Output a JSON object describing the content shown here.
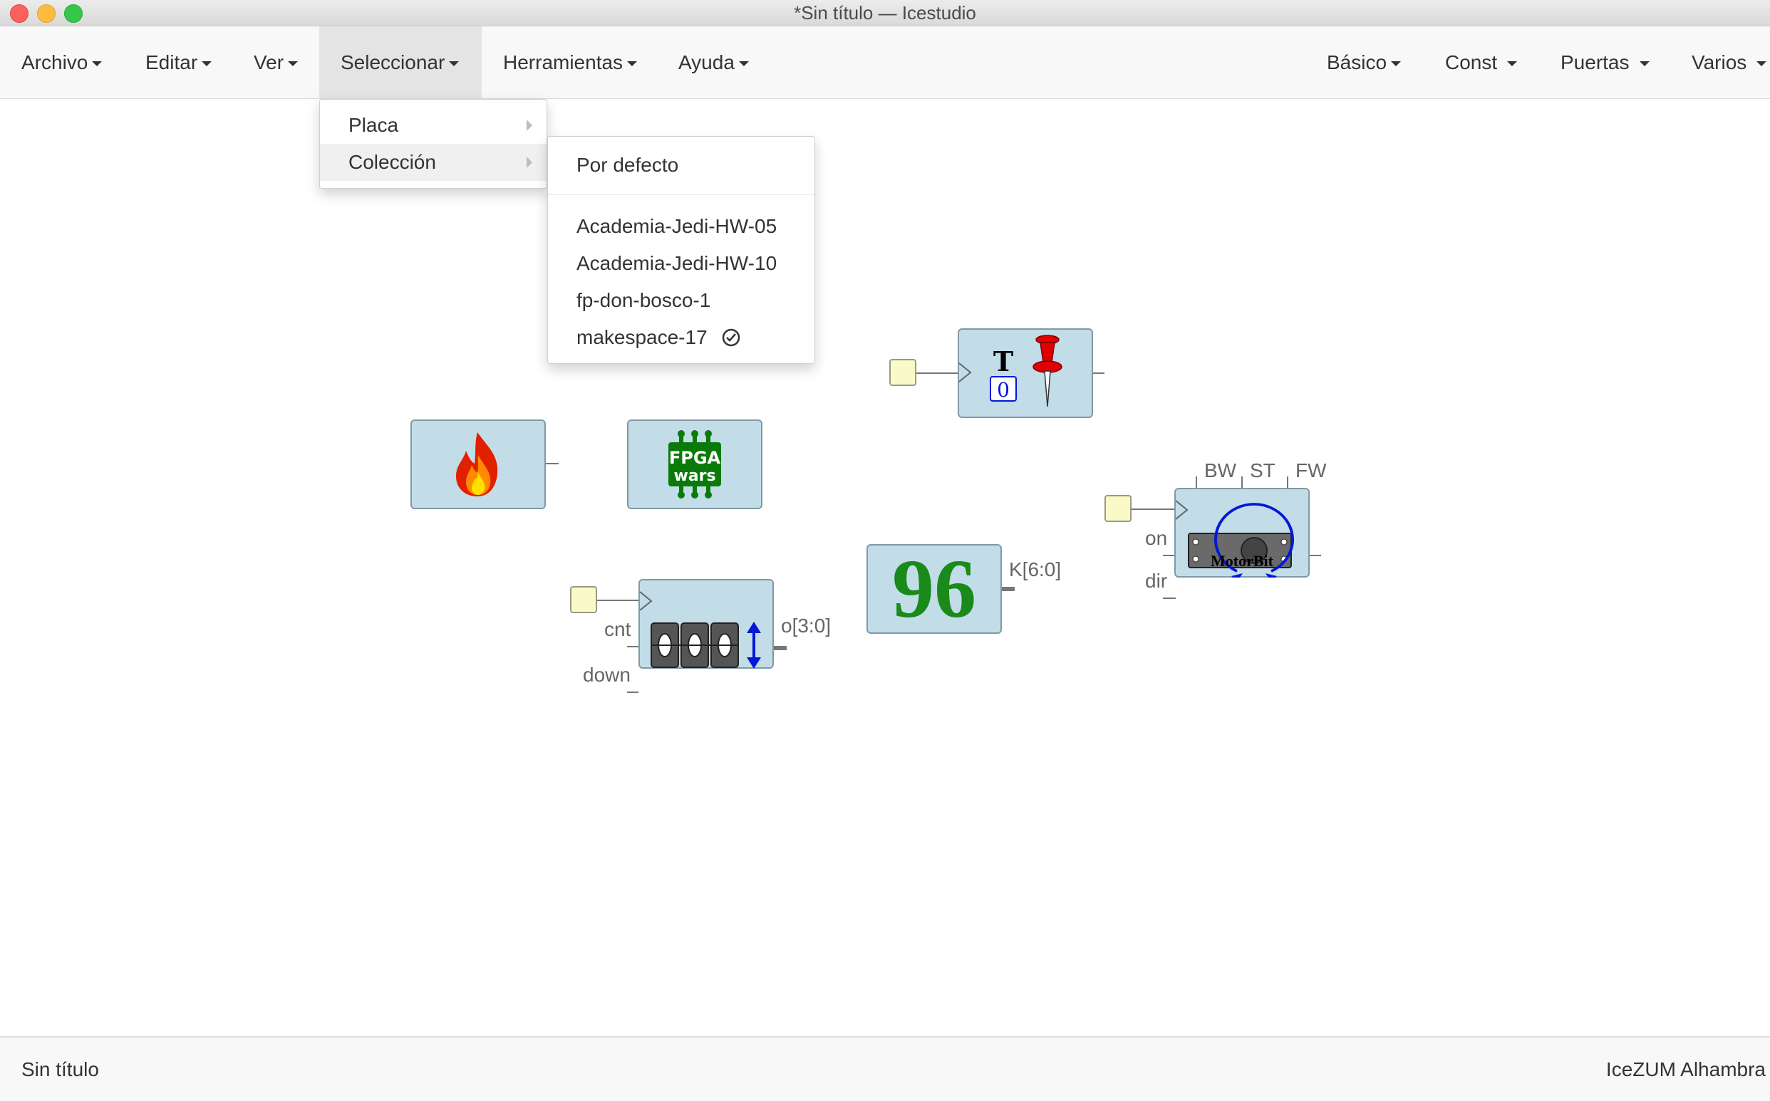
{
  "window": {
    "title": "*Sin título — Icestudio"
  },
  "menubar": {
    "left": [
      {
        "label": "Archivo"
      },
      {
        "label": "Editar"
      },
      {
        "label": "Ver"
      },
      {
        "label": "Seleccionar",
        "active": true
      },
      {
        "label": "Herramientas"
      },
      {
        "label": "Ayuda"
      }
    ],
    "right": [
      {
        "label": "Básico"
      },
      {
        "label": "Const"
      },
      {
        "label": "Puertas"
      },
      {
        "label": "Varios"
      }
    ]
  },
  "select_menu": {
    "items": [
      {
        "label": "Placa"
      },
      {
        "label": "Colección",
        "highlighted": true
      }
    ]
  },
  "collection_menu": {
    "default": "Por defecto",
    "items": [
      {
        "label": "Academia-Jedi-HW-05"
      },
      {
        "label": "Academia-Jedi-HW-10"
      },
      {
        "label": "fp-don-bosco-1"
      },
      {
        "label": "makespace-17",
        "selected": true
      }
    ]
  },
  "canvas": {
    "toggle_block": {
      "t_label": "T",
      "value_label": "0"
    },
    "fpga_block": {
      "logo_line1": "FPGA",
      "logo_line2": "wars"
    },
    "counter_block": {
      "inputs": [
        "cnt",
        "down"
      ],
      "output": "o[3:0]"
    },
    "constant_block": {
      "value": "96",
      "output": "K[6:0]"
    },
    "motor_block": {
      "outputs": [
        "BW",
        "ST",
        "FW"
      ],
      "inputs": [
        "on",
        "dir"
      ],
      "caption": "MotorBit"
    }
  },
  "statusbar": {
    "left": "Sin título",
    "right": "IceZUM Alhambra"
  },
  "colors": {
    "block_fill": "#c2dce8",
    "port_fill": "#fafac8",
    "constant_green": "#1a8a1a",
    "motor_blue": "#0018d8"
  }
}
